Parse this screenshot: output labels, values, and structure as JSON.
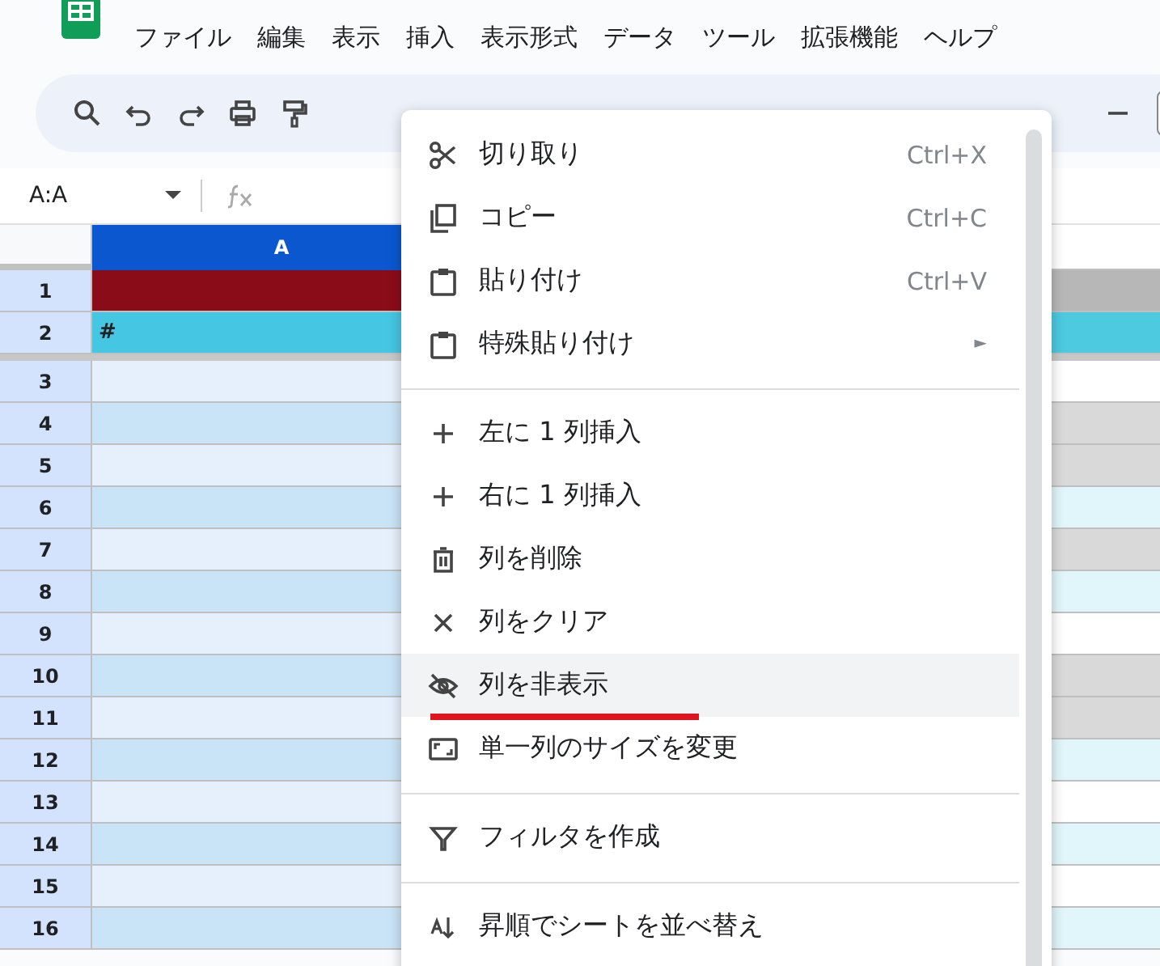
{
  "menu_bar": [
    "ファイル",
    "編集",
    "表示",
    "挿入",
    "表示形式",
    "データ",
    "ツール",
    "拡張機能",
    "ヘルプ"
  ],
  "name_box": {
    "value": "A:A"
  },
  "column_headers": [
    {
      "label": "A",
      "selected": true
    }
  ],
  "rows": [
    {
      "label": "1",
      "kind": "title",
      "color": "#b7b7b7"
    },
    {
      "label": "2",
      "kind": "heading",
      "cells": [
        "#"
      ],
      "color": "#4dc9e0"
    },
    {
      "label": "3",
      "kind": "band",
      "color": "#ffffff"
    },
    {
      "label": "4",
      "kind": "band",
      "color": "#d9d9d9"
    },
    {
      "label": "5",
      "kind": "band",
      "color": "#d9d9d9"
    },
    {
      "label": "6",
      "kind": "band",
      "color": "#e0f6fa"
    },
    {
      "label": "7",
      "kind": "band",
      "color": "#d9d9d9"
    },
    {
      "label": "8",
      "kind": "band",
      "color": "#e0f6fa"
    },
    {
      "label": "9",
      "kind": "band",
      "color": "#ffffff"
    },
    {
      "label": "10",
      "kind": "band",
      "color": "#d9d9d9"
    },
    {
      "label": "11",
      "kind": "band",
      "color": "#d9d9d9"
    },
    {
      "label": "12",
      "kind": "band",
      "color": "#e0f6fa"
    },
    {
      "label": "13",
      "kind": "band",
      "color": "#ffffff"
    },
    {
      "label": "14",
      "kind": "band",
      "color": "#e0f6fa"
    },
    {
      "label": "15",
      "kind": "band",
      "color": "#ffffff"
    },
    {
      "label": "16",
      "kind": "band",
      "color": "#e0f6fa"
    }
  ],
  "context_menu": [
    {
      "kind": "item",
      "label": "切り取り",
      "shortcut": "Ctrl+X",
      "selected": false
    },
    {
      "kind": "item",
      "label": "コピー",
      "shortcut": "Ctrl+C",
      "selected": false
    },
    {
      "kind": "item",
      "label": "貼り付け",
      "shortcut": "Ctrl+V",
      "selected": false
    },
    {
      "kind": "submenu",
      "label": "特殊貼り付け",
      "arrow": "►",
      "selected": false
    },
    {
      "kind": "divider"
    },
    {
      "kind": "item",
      "label": "左に 1 列挿入",
      "selected": false
    },
    {
      "kind": "item",
      "label": "右に 1 列挿入",
      "selected": false
    },
    {
      "kind": "item",
      "label": "列を削除",
      "selected": false
    },
    {
      "kind": "item",
      "label": "列をクリア",
      "selected": false
    },
    {
      "kind": "item",
      "label": "列を非表示",
      "selected": true,
      "underlined": true
    },
    {
      "kind": "item",
      "label": "単一列のサイズを変更",
      "selected": false
    },
    {
      "kind": "divider"
    },
    {
      "kind": "item",
      "label": "フィルタを作成",
      "selected": false
    },
    {
      "kind": "divider"
    },
    {
      "kind": "item",
      "label": "昇順でシートを並べ替え",
      "selected": false
    }
  ]
}
